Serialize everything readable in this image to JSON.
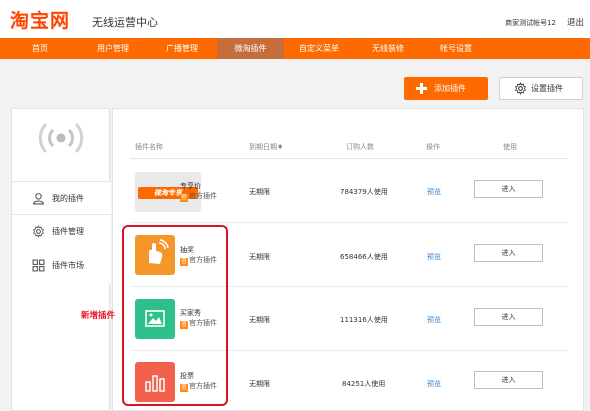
{
  "header": {
    "logo": "淘宝网",
    "subtitle": "无线运营中心",
    "account": "商家测试帐号12",
    "logout": "退出"
  },
  "nav": {
    "items": [
      {
        "label": "首页"
      },
      {
        "label": "用户管理"
      },
      {
        "label": "广播管理"
      },
      {
        "label": "微淘插件",
        "active": true
      },
      {
        "label": "自定义菜单"
      },
      {
        "label": "无线装修"
      },
      {
        "label": "帐号设置"
      }
    ]
  },
  "actions": {
    "add": "添加插件",
    "settings": "设置插件"
  },
  "sidebar": {
    "items": [
      {
        "label": "我的插件",
        "icon": "user-icon",
        "selected": true
      },
      {
        "label": "插件管理",
        "icon": "gear-icon"
      },
      {
        "label": "插件市场",
        "icon": "grid-icon"
      }
    ]
  },
  "table": {
    "headers": [
      "插件名称",
      "到期日期♦",
      "订购人数",
      "操作",
      "使用"
    ],
    "rows": [
      {
        "name": "专享价",
        "official": "官方插件",
        "expiry": "无期限",
        "users": "784379人使用",
        "action": "预览",
        "use": "进入",
        "thumb_text": "微淘专享",
        "icon": "exclusive-badge-icon"
      },
      {
        "name": "抽奖",
        "official": "官方插件",
        "expiry": "无期限",
        "users": "658466人使用",
        "action": "预览",
        "use": "进入",
        "icon": "lottery-hand-icon"
      },
      {
        "name": "买家秀",
        "official": "官方插件",
        "expiry": "无期限",
        "users": "111316人使用",
        "action": "预览",
        "use": "进入",
        "icon": "photo-icon"
      },
      {
        "name": "投票",
        "official": "官方插件",
        "expiry": "无期限",
        "users": "84251人使用",
        "action": "预览",
        "use": "进入",
        "icon": "bar-chart-icon"
      }
    ]
  },
  "official_tag": "官",
  "annotation": "新增插件",
  "colors": {
    "brand": "#ff6a00",
    "nav_active": "#c66d3c",
    "link": "#3a7fc6",
    "annotation": "#e8192c"
  }
}
